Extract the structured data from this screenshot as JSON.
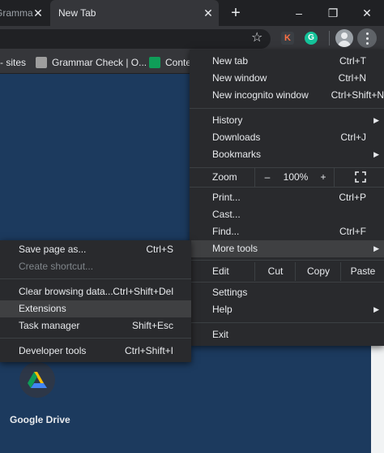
{
  "tabs": [
    {
      "title": "Gramma",
      "active": false
    },
    {
      "title": "New Tab",
      "active": true
    }
  ],
  "window_controls": {
    "minimize": "–",
    "maximize": "❐",
    "close": "✕"
  },
  "new_tab_symbol": "+",
  "extensions": {
    "k_label": "K",
    "g_label": "G"
  },
  "bookmarks": [
    {
      "label": "- sites",
      "icon": "none"
    },
    {
      "label": "Grammar Check | O...",
      "icon": "grammar-icon",
      "color": "#b0b0b0"
    },
    {
      "label": "Conte",
      "icon": "sheets-icon",
      "color": "#0f9d58"
    }
  ],
  "main_menu": {
    "new_tab": {
      "label": "New tab",
      "shortcut": "Ctrl+T"
    },
    "new_window": {
      "label": "New window",
      "shortcut": "Ctrl+N"
    },
    "new_incognito": {
      "label": "New incognito window",
      "shortcut": "Ctrl+Shift+N"
    },
    "history": {
      "label": "History"
    },
    "downloads": {
      "label": "Downloads",
      "shortcut": "Ctrl+J"
    },
    "bookmarks": {
      "label": "Bookmarks"
    },
    "zoom": {
      "label": "Zoom",
      "minus": "–",
      "value": "100%",
      "plus": "+"
    },
    "print": {
      "label": "Print...",
      "shortcut": "Ctrl+P"
    },
    "cast": {
      "label": "Cast..."
    },
    "find": {
      "label": "Find...",
      "shortcut": "Ctrl+F"
    },
    "more_tools": {
      "label": "More tools"
    },
    "edit": {
      "label": "Edit",
      "cut": "Cut",
      "copy": "Copy",
      "paste": "Paste"
    },
    "settings": {
      "label": "Settings"
    },
    "help": {
      "label": "Help"
    },
    "exit": {
      "label": "Exit"
    }
  },
  "sub_menu": {
    "save_page": {
      "label": "Save page as...",
      "shortcut": "Ctrl+S"
    },
    "create_shortcut": {
      "label": "Create shortcut..."
    },
    "clear_browsing": {
      "label": "Clear browsing data...",
      "shortcut": "Ctrl+Shift+Del"
    },
    "extensions": {
      "label": "Extensions"
    },
    "task_manager": {
      "label": "Task manager",
      "shortcut": "Shift+Esc"
    },
    "developer_tools": {
      "label": "Developer tools",
      "shortcut": "Ctrl+Shift+I"
    }
  },
  "page": {
    "drive_label": "Google Drive"
  },
  "colors": {
    "page_bg": "#1c3a5e",
    "menu_bg": "#292a2d",
    "highlight": "#3f4042"
  }
}
